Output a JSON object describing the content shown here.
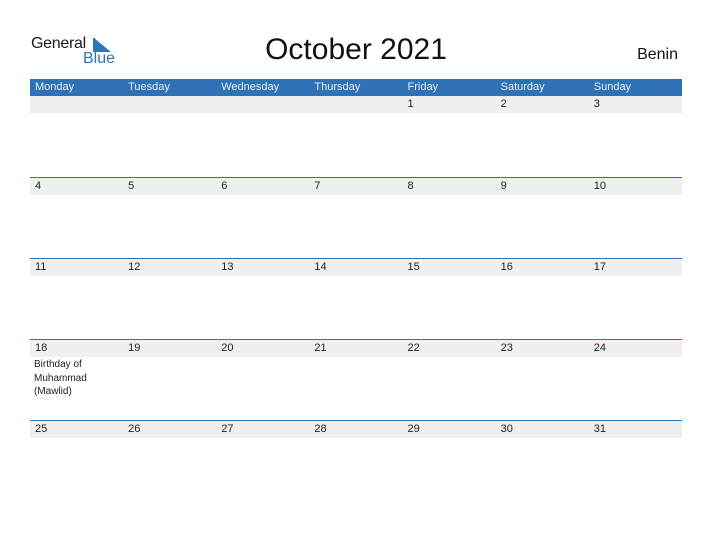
{
  "logo": {
    "word1": "General",
    "word2": "Blue"
  },
  "title": "October 2021",
  "country": "Benin",
  "colors": {
    "accent": "#2e71b4",
    "strip": "#f0f0f0"
  },
  "weekdays": [
    "Monday",
    "Tuesday",
    "Wednesday",
    "Thursday",
    "Friday",
    "Saturday",
    "Sunday"
  ],
  "weeks": [
    {
      "days": [
        "",
        "",
        "",
        "",
        "1",
        "2",
        "3"
      ],
      "events": [
        "",
        "",
        "",
        "",
        "",
        "",
        ""
      ]
    },
    {
      "days": [
        "4",
        "5",
        "6",
        "7",
        "8",
        "9",
        "10"
      ],
      "events": [
        "",
        "",
        "",
        "",
        "",
        "",
        ""
      ]
    },
    {
      "days": [
        "11",
        "12",
        "13",
        "14",
        "15",
        "16",
        "17"
      ],
      "events": [
        "",
        "",
        "",
        "",
        "",
        "",
        ""
      ]
    },
    {
      "days": [
        "18",
        "19",
        "20",
        "21",
        "22",
        "23",
        "24"
      ],
      "events": [
        "Birthday of Muhammad (Mawlid)",
        "",
        "",
        "",
        "",
        "",
        ""
      ]
    },
    {
      "days": [
        "25",
        "26",
        "27",
        "28",
        "29",
        "30",
        "31"
      ],
      "events": [
        "",
        "",
        "",
        "",
        "",
        "",
        ""
      ]
    }
  ]
}
